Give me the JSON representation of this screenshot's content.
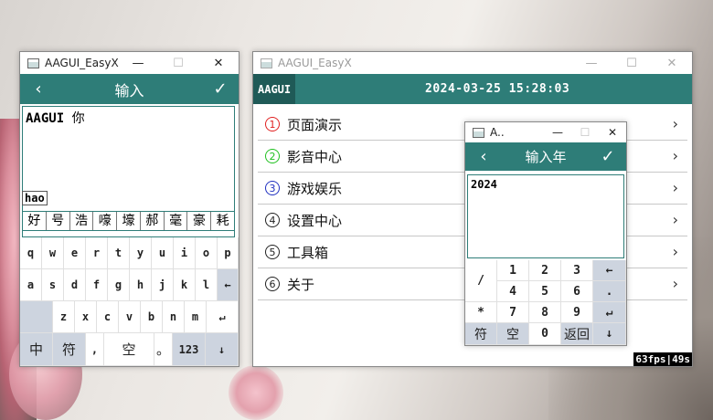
{
  "left_window": {
    "title": "AAGUI_EasyX",
    "controls": {
      "minimize": "—",
      "maximize": "☐",
      "close": "✕"
    },
    "header": {
      "back": "‹",
      "title": "输入",
      "ok": "✓"
    },
    "text_prefix": "AAGUI",
    "text_cjk": "你",
    "pinyin": "hao",
    "candidates": [
      "好",
      "号",
      "浩",
      "嚎",
      "壕",
      "郝",
      "毫",
      "豪",
      "耗"
    ],
    "keyboard_row1": [
      "q",
      "w",
      "e",
      "r",
      "t",
      "y",
      "u",
      "i",
      "o",
      "p"
    ],
    "keyboard_row2": [
      "a",
      "s",
      "d",
      "f",
      "g",
      "h",
      "j",
      "k",
      "l",
      "←"
    ],
    "keyboard_row3": [
      "z",
      "x",
      "c",
      "v",
      "b",
      "n",
      "m",
      "↵"
    ],
    "keyboard_row4": {
      "lang": "中",
      "symbol": "符",
      "comma": ",",
      "space": "空",
      "period": "。",
      "numbers": "123",
      "down": "↓"
    }
  },
  "main_window": {
    "title": "AAGUI_EasyX",
    "controls": {
      "minimize": "—",
      "maximize": "☐",
      "close": "✕"
    },
    "tag": "AAGUI",
    "datetime": "2024-03-25 15:28:03",
    "menu": [
      {
        "num": "1",
        "label": "页面演示",
        "color": "#e02020"
      },
      {
        "num": "2",
        "label": "影音中心",
        "color": "#20c020"
      },
      {
        "num": "3",
        "label": "游戏娱乐",
        "color": "#2030c0"
      },
      {
        "num": "4",
        "label": "设置中心",
        "color": "#222222"
      },
      {
        "num": "5",
        "label": "工具箱",
        "color": "#222222"
      },
      {
        "num": "6",
        "label": "关于",
        "color": "#222222"
      }
    ],
    "chevron": "›",
    "fps": "63fps|49s"
  },
  "num_window": {
    "title": "A..",
    "controls": {
      "minimize": "—",
      "maximize": "☐",
      "close": "✕"
    },
    "header": {
      "back": "‹",
      "title": "输入年",
      "ok": "✓"
    },
    "value": "2024",
    "keys": {
      "slash": "/",
      "k1": "1",
      "k2": "2",
      "k3": "3",
      "backspace": "←",
      "star": "*",
      "k4": "4",
      "k5": "5",
      "k6": "6",
      "dot": ".",
      "k7": "7",
      "k8": "8",
      "k9": "9",
      "enter": "↵",
      "symbol": "符",
      "space": "空",
      "k0": "0",
      "back": "返回",
      "down": "↓"
    }
  },
  "colors": {
    "accent": "#2e7d78",
    "accent_dark": "#1f5a57",
    "key_dark": "#cdd4df"
  }
}
